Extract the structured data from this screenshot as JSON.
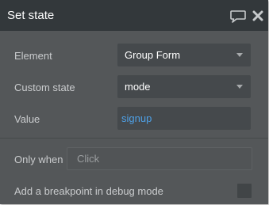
{
  "dialog": {
    "title": "Set state",
    "icons": {
      "comment": "comment-icon",
      "close": "close-icon"
    }
  },
  "fields": {
    "element": {
      "label": "Element",
      "value": "Group Form"
    },
    "custom_state": {
      "label": "Custom state",
      "value": "mode"
    },
    "value": {
      "label": "Value",
      "value": "signup"
    }
  },
  "condition": {
    "label": "Only when",
    "placeholder": "Click"
  },
  "debug": {
    "label": "Add a breakpoint in debug mode",
    "checked": false
  },
  "colors": {
    "panel": "#545759",
    "titlebar": "#33383b",
    "field": "#45494c",
    "link": "#4ea0e6"
  }
}
